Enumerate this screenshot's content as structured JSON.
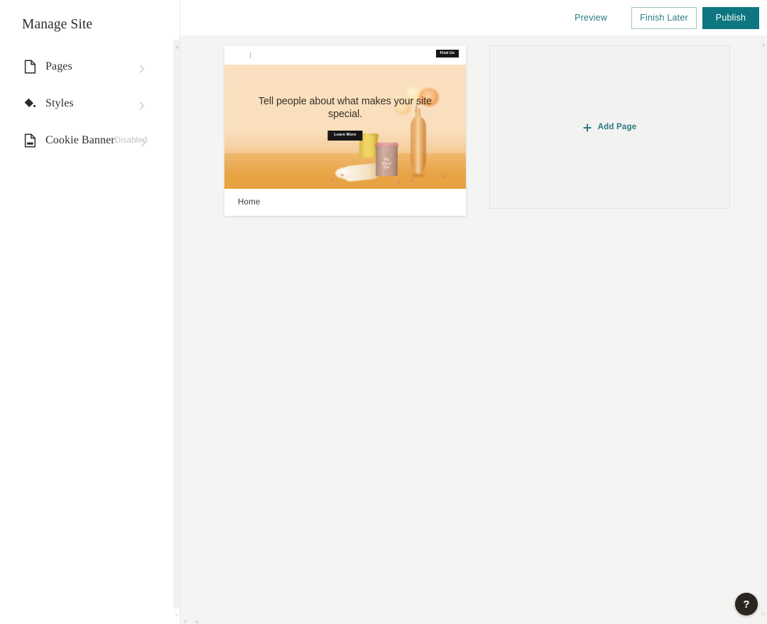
{
  "sidebar": {
    "title": "Manage Site",
    "items": [
      {
        "label": "Pages",
        "icon": "page-icon",
        "status": "",
        "chevron": "chevron-right-icon"
      },
      {
        "label": "Styles",
        "icon": "paint-diamond-icon",
        "status": "",
        "chevron": "chevron-right-icon"
      },
      {
        "label": "Cookie Banner",
        "icon": "cookie-banner-icon",
        "status": "Disabled",
        "chevron": "chevron-right-icon"
      }
    ]
  },
  "topbar": {
    "preview_label": "Preview",
    "finish_later_label": "Finish Later",
    "publish_label": "Publish"
  },
  "pages": [
    {
      "name": "Home",
      "thumbnail": {
        "nav_button_label": "Find Us",
        "hero_heading": "Tell people about what makes your site special.",
        "hero_button_label": "Learn More",
        "product_label": "Big\nWood\nSpa"
      }
    }
  ],
  "add_page": {
    "label": "Add Page",
    "icon": "plus-icon"
  },
  "help": {
    "label": "?",
    "icon": "question-mark-icon"
  },
  "colors": {
    "accent_teal": "#0d7680",
    "link_teal": "#2a7b84",
    "canvas_bg": "#f4f4f2",
    "sidebar_bg": "#ffffff",
    "muted_text": "#c2c2c2",
    "help_fab_bg": "#2b2520"
  }
}
